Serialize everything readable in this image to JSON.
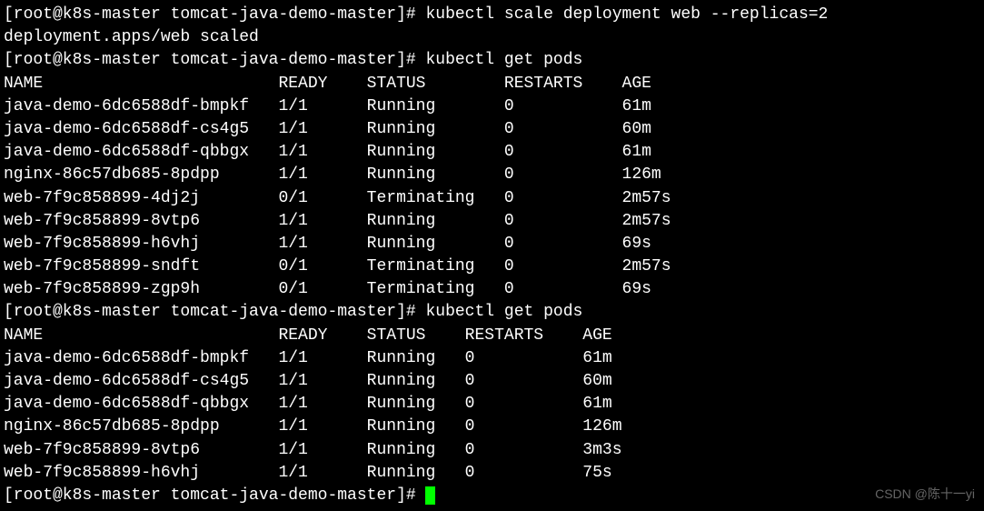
{
  "prompt": {
    "user": "root",
    "host": "k8s-master",
    "cwd": "tomcat-java-demo-master",
    "prefix": "[root@k8s-master tomcat-java-demo-master]#"
  },
  "commands": {
    "cmd1": "kubectl scale deployment web --replicas=2",
    "cmd1_output": "deployment.apps/web scaled",
    "cmd2": "kubectl get pods",
    "cmd3": "kubectl get pods"
  },
  "table1": {
    "header": {
      "name": "NAME",
      "ready": "READY",
      "status": "STATUS",
      "restarts": "RESTARTS",
      "age": "AGE"
    },
    "rows": [
      {
        "name": "java-demo-6dc6588df-bmpkf",
        "ready": "1/1",
        "status": "Running",
        "restarts": "0",
        "age": "61m"
      },
      {
        "name": "java-demo-6dc6588df-cs4g5",
        "ready": "1/1",
        "status": "Running",
        "restarts": "0",
        "age": "60m"
      },
      {
        "name": "java-demo-6dc6588df-qbbgx",
        "ready": "1/1",
        "status": "Running",
        "restarts": "0",
        "age": "61m"
      },
      {
        "name": "nginx-86c57db685-8pdpp",
        "ready": "1/1",
        "status": "Running",
        "restarts": "0",
        "age": "126m"
      },
      {
        "name": "web-7f9c858899-4dj2j",
        "ready": "0/1",
        "status": "Terminating",
        "restarts": "0",
        "age": "2m57s"
      },
      {
        "name": "web-7f9c858899-8vtp6",
        "ready": "1/1",
        "status": "Running",
        "restarts": "0",
        "age": "2m57s"
      },
      {
        "name": "web-7f9c858899-h6vhj",
        "ready": "1/1",
        "status": "Running",
        "restarts": "0",
        "age": "69s"
      },
      {
        "name": "web-7f9c858899-sndft",
        "ready": "0/1",
        "status": "Terminating",
        "restarts": "0",
        "age": "2m57s"
      },
      {
        "name": "web-7f9c858899-zgp9h",
        "ready": "0/1",
        "status": "Terminating",
        "restarts": "0",
        "age": "69s"
      }
    ]
  },
  "table2": {
    "header": {
      "name": "NAME",
      "ready": "READY",
      "status": "STATUS",
      "restarts": "RESTARTS",
      "age": "AGE"
    },
    "rows": [
      {
        "name": "java-demo-6dc6588df-bmpkf",
        "ready": "1/1",
        "status": "Running",
        "restarts": "0",
        "age": "61m"
      },
      {
        "name": "java-demo-6dc6588df-cs4g5",
        "ready": "1/1",
        "status": "Running",
        "restarts": "0",
        "age": "60m"
      },
      {
        "name": "java-demo-6dc6588df-qbbgx",
        "ready": "1/1",
        "status": "Running",
        "restarts": "0",
        "age": "61m"
      },
      {
        "name": "nginx-86c57db685-8pdpp",
        "ready": "1/1",
        "status": "Running",
        "restarts": "0",
        "age": "126m"
      },
      {
        "name": "web-7f9c858899-8vtp6",
        "ready": "1/1",
        "status": "Running",
        "restarts": "0",
        "age": "3m3s"
      },
      {
        "name": "web-7f9c858899-h6vhj",
        "ready": "1/1",
        "status": "Running",
        "restarts": "0",
        "age": "75s"
      }
    ]
  },
  "watermark": "CSDN @陈十一yi"
}
